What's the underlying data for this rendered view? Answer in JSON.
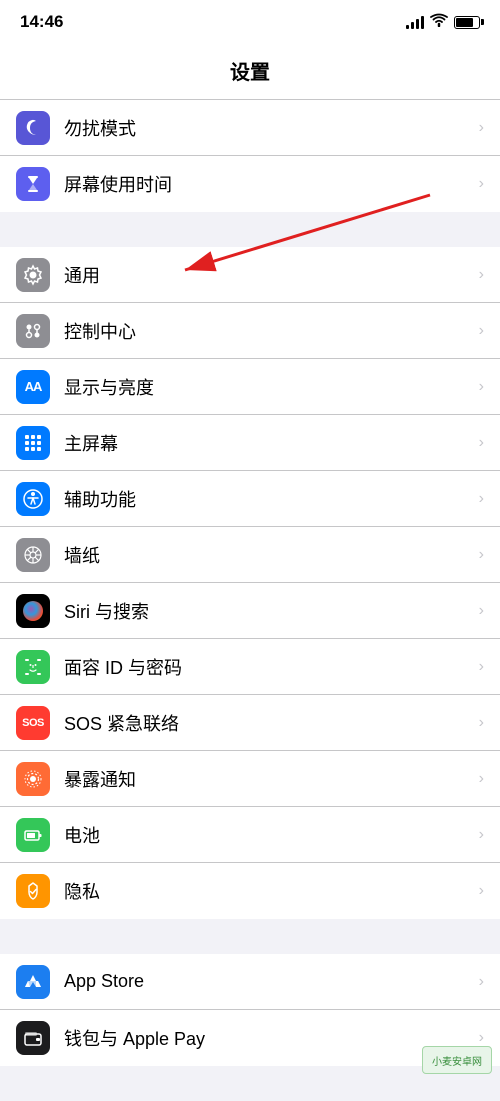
{
  "statusBar": {
    "time": "14:46",
    "signal": "signal",
    "wifi": "wifi",
    "battery": "battery"
  },
  "pageTitle": "设置",
  "groups": [
    {
      "id": "group1",
      "items": [
        {
          "id": "do-not-disturb",
          "label": "勿扰模式",
          "iconType": "moon",
          "iconBg": "purple"
        },
        {
          "id": "screen-time",
          "label": "屏幕使用时间",
          "iconType": "hourglass",
          "iconBg": "blue-time"
        }
      ]
    },
    {
      "id": "group2",
      "items": [
        {
          "id": "general",
          "label": "通用",
          "iconType": "gear",
          "iconBg": "gray",
          "arrow": true
        },
        {
          "id": "control-center",
          "label": "控制中心",
          "iconType": "sliders",
          "iconBg": "gray"
        },
        {
          "id": "display",
          "label": "显示与亮度",
          "iconType": "AA",
          "iconBg": "blue"
        },
        {
          "id": "home-screen",
          "label": "主屏幕",
          "iconType": "dots",
          "iconBg": "blue"
        },
        {
          "id": "accessibility",
          "label": "辅助功能",
          "iconType": "person-circle",
          "iconBg": "blue"
        },
        {
          "id": "wallpaper",
          "label": "墙纸",
          "iconType": "flower",
          "iconBg": "gray"
        },
        {
          "id": "siri",
          "label": "Siri 与搜索",
          "iconType": "siri",
          "iconBg": "dark"
        },
        {
          "id": "faceid",
          "label": "面容 ID 与密码",
          "iconType": "faceid",
          "iconBg": "green"
        },
        {
          "id": "sos",
          "label": "SOS 紧急联络",
          "iconType": "sos",
          "iconBg": "red"
        },
        {
          "id": "exposure",
          "label": "暴露通知",
          "iconType": "exposure",
          "iconBg": "orange"
        },
        {
          "id": "battery",
          "label": "电池",
          "iconType": "battery",
          "iconBg": "green"
        },
        {
          "id": "privacy",
          "label": "隐私",
          "iconType": "hand",
          "iconBg": "orange-hand"
        }
      ]
    },
    {
      "id": "group3",
      "items": [
        {
          "id": "app-store",
          "label": "App Store",
          "iconType": "appstore",
          "iconBg": "blue-store"
        },
        {
          "id": "wallet",
          "label": "钱包与 Apple Pay",
          "iconType": "wallet",
          "iconBg": "dark-wallet"
        }
      ]
    }
  ],
  "watermark": "小麦安卓网"
}
